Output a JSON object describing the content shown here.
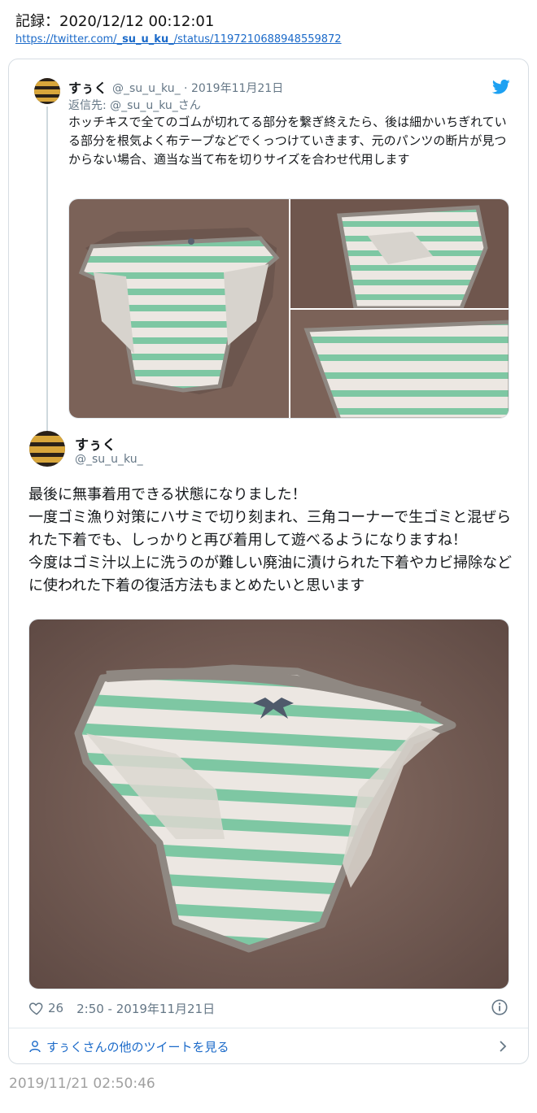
{
  "record": {
    "title": "記録：2020/12/12 00:12:01",
    "url_prefix": "https://twitter.com/",
    "url_handle": "_su_u_ku_",
    "url_suffix": "/status/1197210688948559872"
  },
  "parent_tweet": {
    "name": "すぅく",
    "handle_date": "@_su_u_ku_ · 2019年11月21日",
    "reply_to": "返信先: @_su_u_ku_さん",
    "text": "ホッチキスで全てのゴムが切れてる部分を繋ぎ終えたら、後は細かいちぎれている部分を根気よく布テープなどでくっつけていきます、元のパンツの断片が見つからない場合、適当な当て布を切りサイズを合わせ代用します"
  },
  "main_tweet": {
    "name": "すぅく",
    "handle": "@_su_u_ku_",
    "text": "最後に無事着用できる状態になりました！\n一度ゴミ漁り対策にハサミで切り刻まれ、三角コーナーで生ゴミと混ぜられた下着でも、しっかりと再び着用して遊べるようになりますね！\n今度はゴミ汁以上に洗うのが難しい廃油に漬けられた下着やカビ掃除などに使われた下着の復活方法もまとめたいと思います",
    "likes": "26",
    "time": "2:50 - 2019年11月21日"
  },
  "footer": {
    "more_tweets": "すぅくさんの他のツイートを見る"
  },
  "archive_timestamp": "2019/11/21 02:50:46",
  "colors": {
    "link": "#1b6ac9",
    "twitter_blue": "#1da1f2",
    "photo_bg": "#7b6258",
    "stripe_green": "#7ec7a3",
    "fabric_white": "#ece7e2",
    "trim_gray": "#8f8882"
  }
}
